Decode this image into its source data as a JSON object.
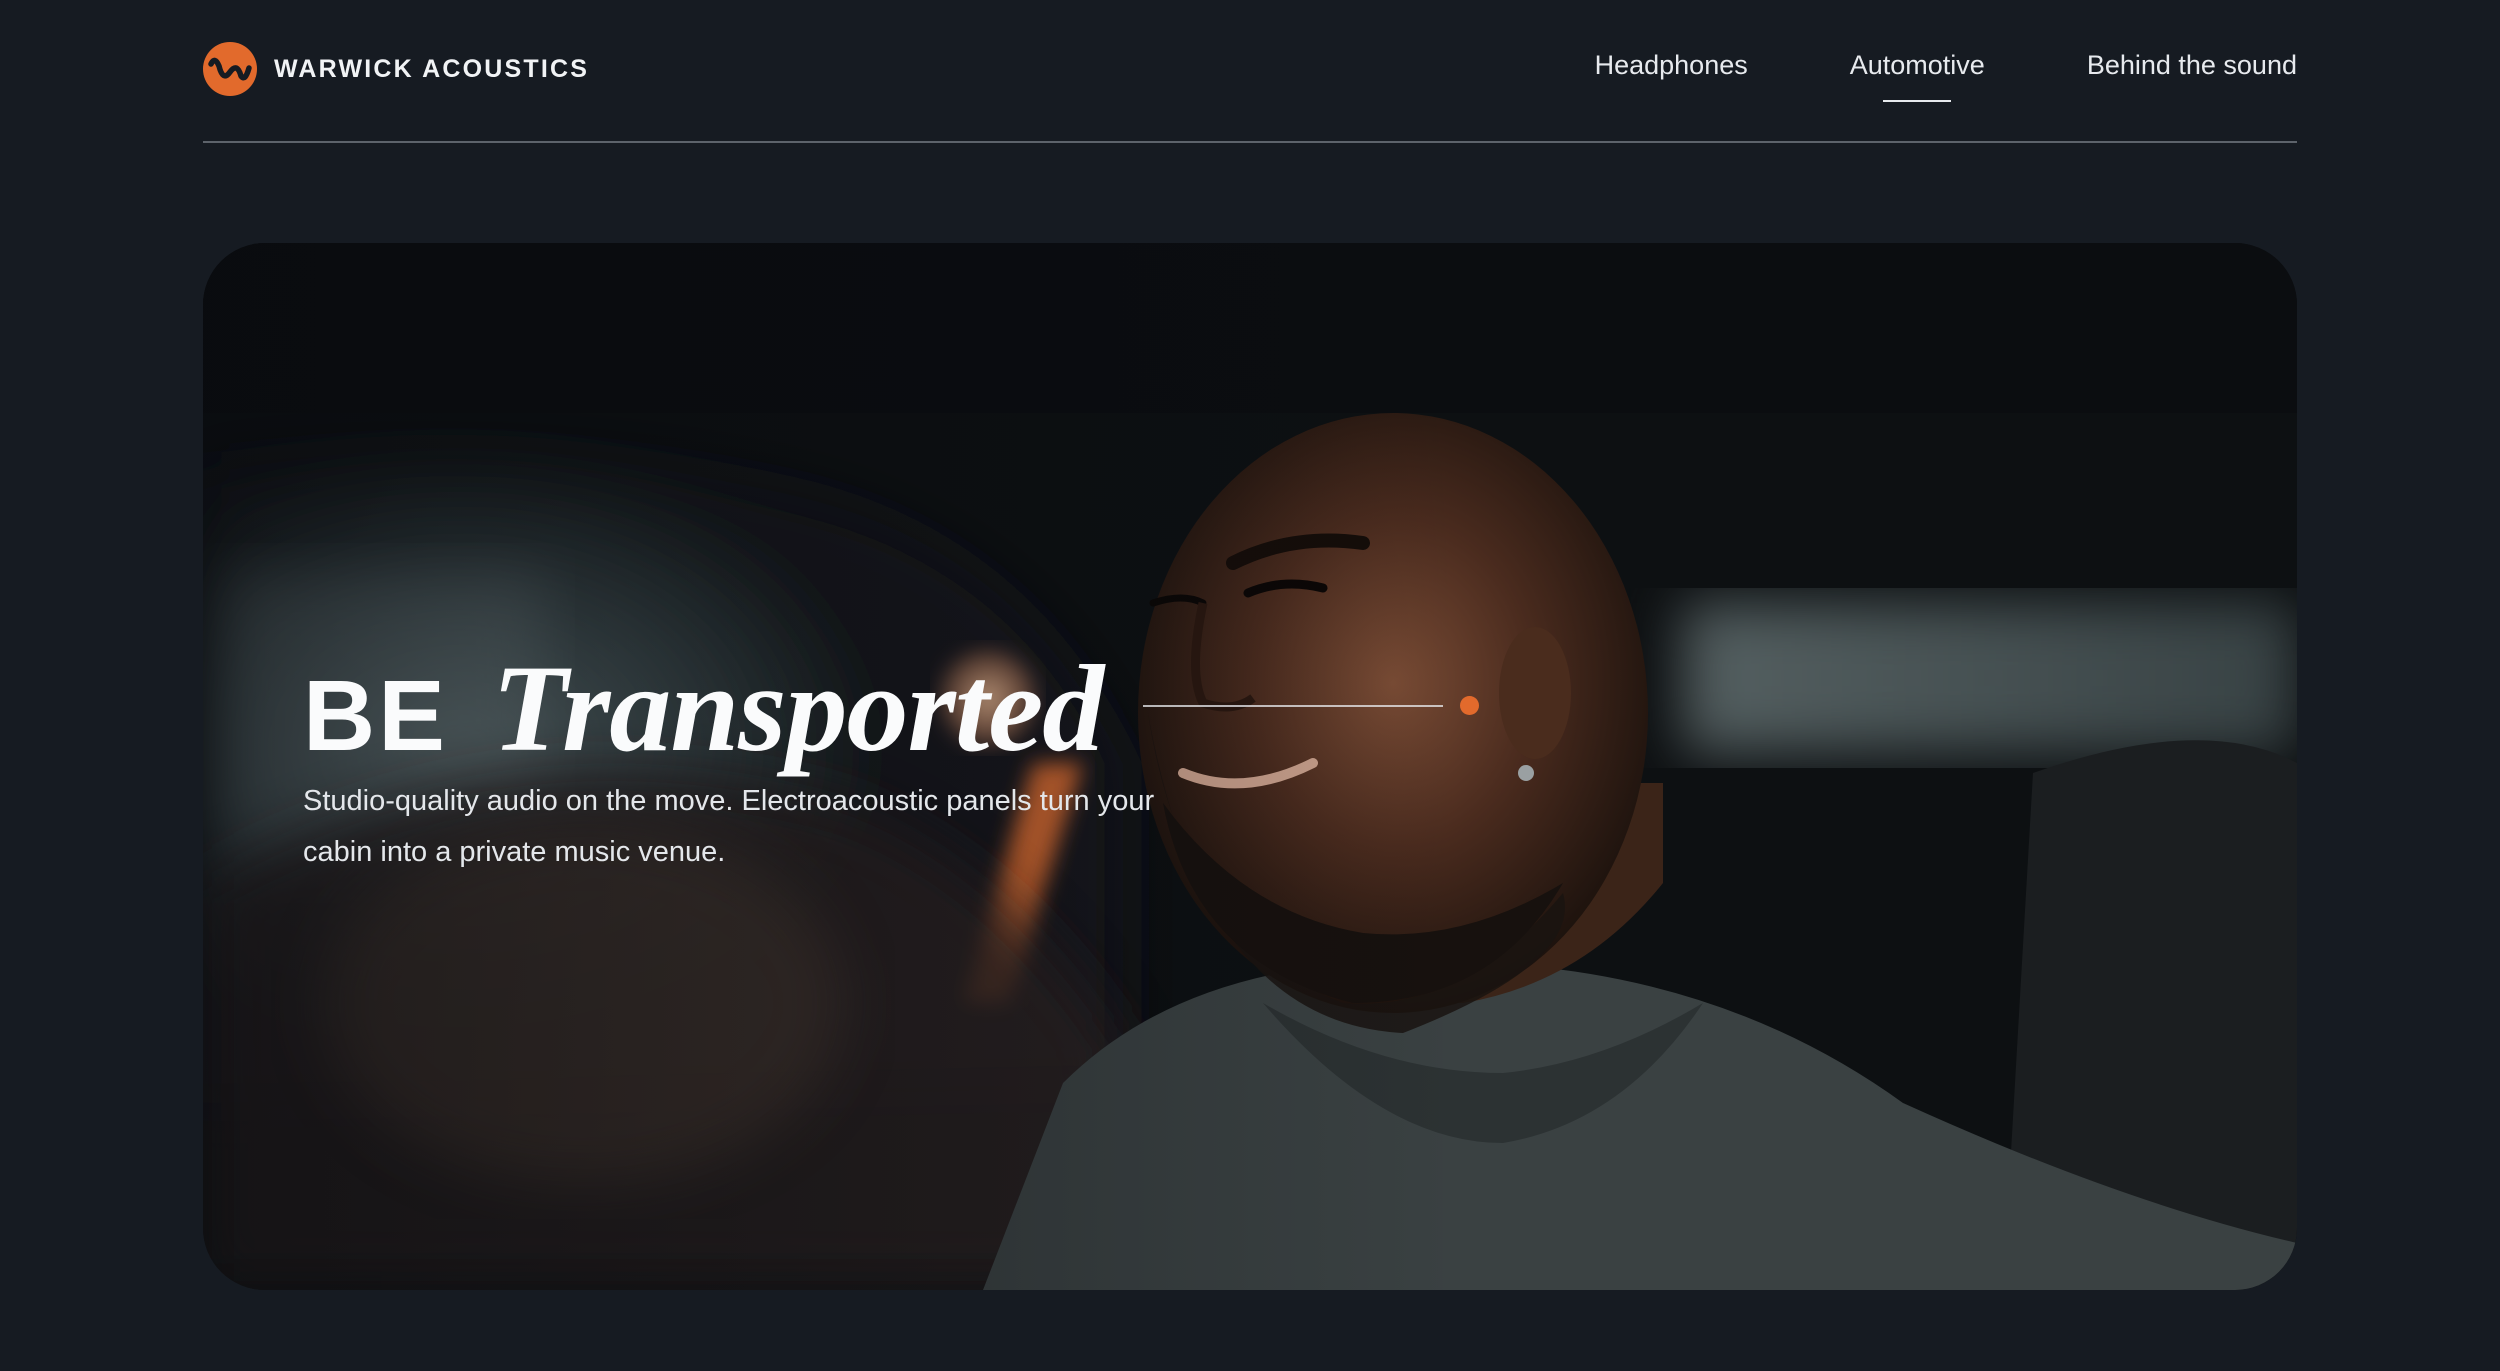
{
  "brand": {
    "name": "WARWICK ACOUSTICS",
    "logo_icon": "wave-logo-icon",
    "accent_color": "#e26a2c"
  },
  "nav": {
    "items": [
      {
        "label": "Headphones",
        "active": false
      },
      {
        "label": "Automotive",
        "active": true
      },
      {
        "label": "Behind the sound",
        "active": false
      }
    ]
  },
  "hero": {
    "title_caps": "BE",
    "title_script": "Transported",
    "subtitle_line1": "Studio-quality audio on the move. Electroacoustic panels turn your",
    "subtitle_line2": "cabin into a private music venue.",
    "image": "man-driving-car-photo"
  },
  "colors": {
    "background": "#161b22",
    "accent": "#e26a2c",
    "text": "#e9ecef"
  }
}
